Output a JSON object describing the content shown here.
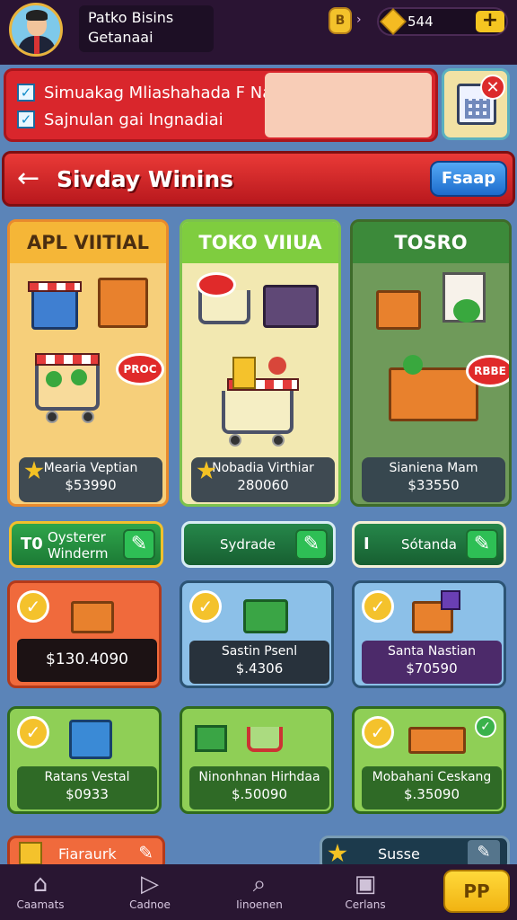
{
  "header": {
    "player_name": "Patko Bisins",
    "player_sub": "Getanaai",
    "coin_badge": "B",
    "currency_value": "544",
    "plus_label": "+"
  },
  "notification": {
    "line1": "Simuakag Mliashahada F Nag",
    "line2": "Sajnulan gai Ingnadiai",
    "check_symbol": "✓",
    "close_symbol": "✕"
  },
  "title_bar": {
    "back_symbol": "←",
    "title": "Sivday Winins",
    "action": "Fsaap"
  },
  "categories": [
    {
      "title": "APL VIITIAL",
      "item_name": "Mearia Veptian",
      "price": "$53990",
      "tag": "PROC"
    },
    {
      "title": "TOKO VIIUA",
      "item_name": "Nobadia Virthiar",
      "price": "280060"
    },
    {
      "title": "TOSRO",
      "item_name": "Sianiena Mam",
      "price": "$33550",
      "tag": "RBBE"
    }
  ],
  "modes": [
    {
      "label_line1": "Oysterer",
      "label_line2": "Winderm",
      "icon": "T0"
    },
    {
      "label_line1": "Sydrade",
      "label_line2": ""
    },
    {
      "label_line1": "Sótanda",
      "label_line2": "",
      "icon": "I"
    }
  ],
  "products": [
    {
      "name": "",
      "price": "$130.4090"
    },
    {
      "name": "Sastin Psenl",
      "price": "$.4306"
    },
    {
      "name": "Santa Nastian",
      "price": "$70590"
    },
    {
      "name": "Ratans Vestal",
      "price": "$0933"
    },
    {
      "name": "Ninonhnan Hirhdaa",
      "price": "$.50090"
    },
    {
      "name": "Mobahani Ceskang",
      "price": "$.35090"
    }
  ],
  "partial_row": {
    "left_label": "Fiaraurk",
    "right_label": "Susse"
  },
  "bottom_nav": [
    {
      "label": "Caamats"
    },
    {
      "label": "Cadnoe"
    },
    {
      "label": "Iinoenen"
    },
    {
      "label": "Cerlans"
    }
  ],
  "bottom_cta": "PP",
  "colors": {
    "background": "#5b84b8",
    "topbar": "#2a1433",
    "accent_red": "#d9262c",
    "accent_green": "#2fa54b",
    "accent_gold": "#f5c521"
  }
}
